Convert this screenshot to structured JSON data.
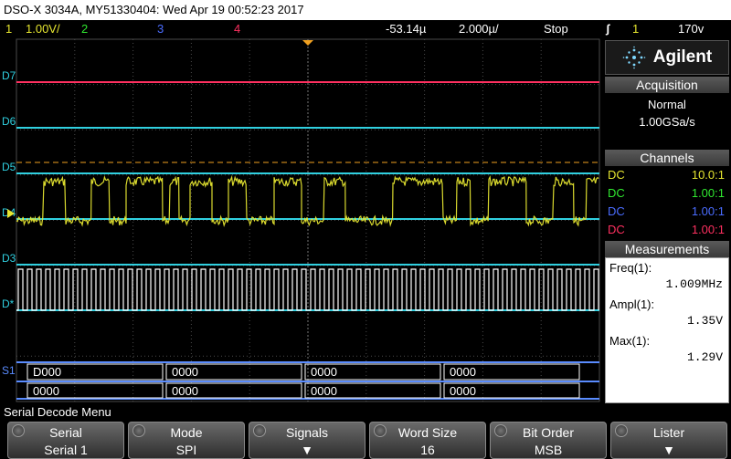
{
  "title": "DSO-X 3034A, MY51330404: Wed Apr 19 00:52:23 2017",
  "status": {
    "ch1_num": "1",
    "ch1_scale": "1.00V/",
    "ch2_num": "2",
    "ch3_num": "3",
    "ch4_num": "4",
    "delay": "-53.14µ",
    "timebase": "2.000µ/",
    "run_state": "Stop",
    "trigger_icon": "rising-edge-icon",
    "trigger_source": "1",
    "trigger_level": "170v"
  },
  "colors": {
    "ch1": "#e6e630",
    "ch2": "#30e830",
    "ch3": "#4a6cff",
    "ch4": "#ff3060",
    "digital": "#30d0e0",
    "grid": "#4a4a4a",
    "serial_bus": "#5a8cff"
  },
  "digital_labels": [
    "D7",
    "D6",
    "D5",
    "D4",
    "D3",
    "D*"
  ],
  "serial_label": "S1",
  "decode": {
    "row1": [
      "D000",
      "0000",
      "0000",
      "0000"
    ],
    "row2": [
      "0000",
      "0000",
      "0000",
      "0000"
    ]
  },
  "panel": {
    "brand": "Agilent",
    "acquisition_title": "Acquisition",
    "acq_mode": "Normal",
    "acq_rate": "1.00GSa/s",
    "channels_title": "Channels",
    "channels": [
      {
        "coupling": "DC",
        "probe": "10.0:1",
        "color": "#e6e630"
      },
      {
        "coupling": "DC",
        "probe": "1.00:1",
        "color": "#30e830"
      },
      {
        "coupling": "DC",
        "probe": "1.00:1",
        "color": "#4a6cff"
      },
      {
        "coupling": "DC",
        "probe": "1.00:1",
        "color": "#ff3060"
      }
    ],
    "measurements_title": "Measurements",
    "measurements": [
      {
        "name": "Freq(1):",
        "value": "1.009MHz"
      },
      {
        "name": "Ampl(1):",
        "value": "1.35V"
      },
      {
        "name": "Max(1):",
        "value": "1.29V"
      }
    ]
  },
  "menu_title": "Serial Decode Menu",
  "softkeys": [
    {
      "label": "Serial",
      "value": "Serial 1"
    },
    {
      "label": "Mode",
      "value": "SPI"
    },
    {
      "label": "Signals",
      "value": ""
    },
    {
      "label": "Word Size",
      "value": "16"
    },
    {
      "label": "Bit Order",
      "value": "MSB"
    },
    {
      "label": "Lister",
      "value": ""
    }
  ]
}
